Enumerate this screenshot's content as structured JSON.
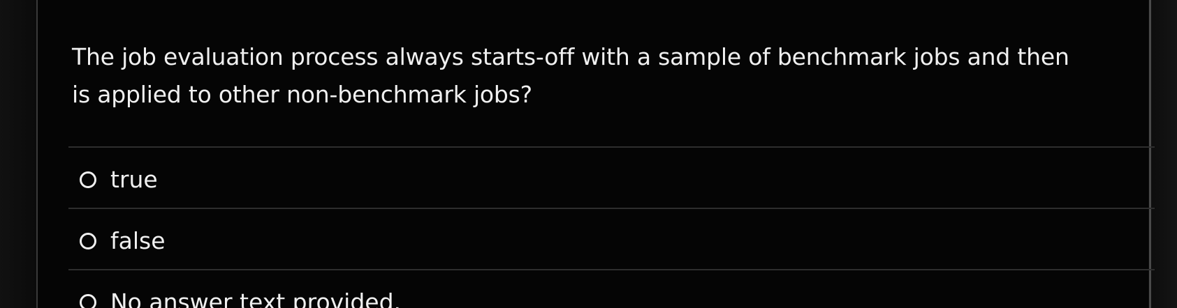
{
  "question": {
    "text": "The job evaluation process always starts-off with a sample of benchmark jobs and then is applied to other non-benchmark jobs?"
  },
  "answers": [
    {
      "label": "true",
      "selected": false
    },
    {
      "label": "false",
      "selected": false
    },
    {
      "label": "No answer text provided.",
      "selected": false
    }
  ],
  "colors": {
    "background": "#050505",
    "text": "#f0f0f0",
    "divider": "#2e2e2e"
  }
}
